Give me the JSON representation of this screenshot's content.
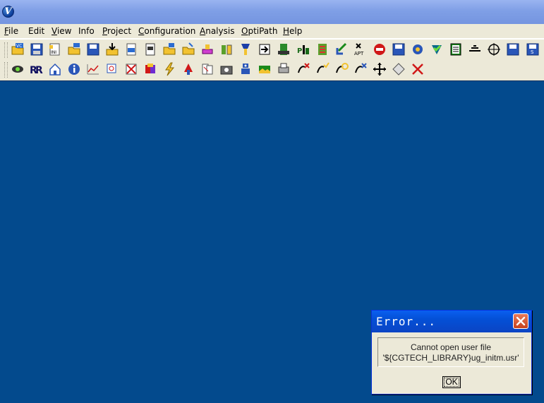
{
  "window": {
    "logo_letter": "V"
  },
  "menubar": {
    "items": [
      {
        "mnemonic": "F",
        "rest": "ile"
      },
      {
        "mnemonic": "",
        "rest": "Edit"
      },
      {
        "mnemonic": "V",
        "rest": "iew"
      },
      {
        "mnemonic": "",
        "rest": "Info"
      },
      {
        "mnemonic": "P",
        "rest": "roject"
      },
      {
        "mnemonic": "C",
        "rest": "onfiguration"
      },
      {
        "mnemonic": "A",
        "rest": "nalysis"
      },
      {
        "mnemonic": "O",
        "rest": "ptiPath"
      },
      {
        "mnemonic": "H",
        "rest": "elp"
      }
    ]
  },
  "toolbar": {
    "row1_icons": [
      "open-vc-icon",
      "save-vc-icon",
      "open-ini-icon",
      "open-ip-icon",
      "save-ip-icon",
      "import-icon",
      "open-nc-icon",
      "nc-file-icon",
      "open-folder-m-icon",
      "open-folder-s-icon",
      "stock-icon",
      "fixture-icon",
      "tool-icon",
      "insert-icon",
      "machine-icon",
      "plc-icon",
      "gcode-icon",
      "arrow-in-icon",
      "apt-icon",
      "stop-icon",
      "save-disk-icon",
      "options-icon",
      "check-icon",
      "report-icon",
      "table-icon",
      "target-icon",
      "save-vc2-icon",
      "save-s-icon"
    ],
    "row1_labels": {
      "ini": "INI",
      "apt": "APT"
    },
    "row2_icons": [
      "view-icon",
      "reset-icon",
      "home-icon",
      "info-icon",
      "chart-icon",
      "zoom-icon",
      "delete-image-icon",
      "color-cube-icon",
      "lightning-icon",
      "cutter-icon",
      "pages-icon",
      "camera-icon",
      "robot-icon",
      "image-icon",
      "print-icon",
      "collision-x-icon",
      "collision-check-icon",
      "collision-refresh-icon",
      "collision-settings-icon",
      "move-icon",
      "diamond-icon",
      "close-red-x-icon"
    ]
  },
  "dialog": {
    "title": "Error...",
    "message_line1": "Cannot open user file",
    "message_line2": "'${CGTECH_LIBRARY}ug_initm.usr'",
    "ok_label": "OK",
    "colors": {
      "title_bar": "#0450d6",
      "close_button": "#d6522b"
    }
  },
  "colors": {
    "workspace": "#034a8d",
    "chrome": "#ece9d8",
    "titlebar": "#7f9fe6"
  }
}
